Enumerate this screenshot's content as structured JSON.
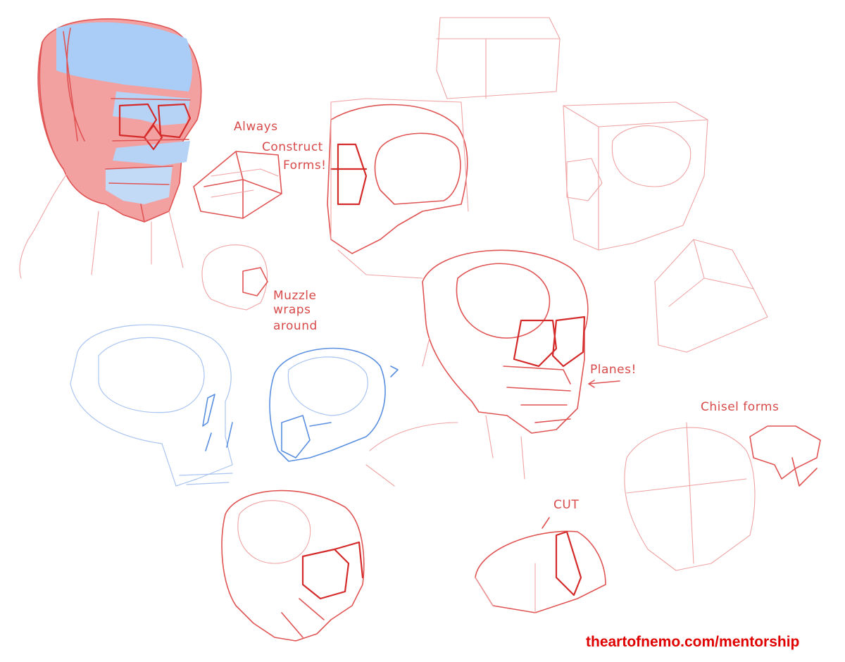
{
  "sheet": {
    "annotations": {
      "always": "Always",
      "construct": "Construct",
      "forms": "Forms!",
      "muzzle_1": "Muzzle",
      "muzzle_2": "wraps",
      "muzzle_3": "around",
      "planes": "Planes!",
      "cut": "CUT",
      "chisel": "Chisel forms"
    },
    "credit": "theartofnemo.com/mentorship"
  },
  "colors": {
    "red_ink": "#e05454",
    "light_red_ink": "#efa3a3",
    "blue_ink": "#5a8fe0",
    "red_fill": "#f08a8a",
    "blue_fill": "#9cc4f4",
    "credit_red": "#e00000"
  }
}
